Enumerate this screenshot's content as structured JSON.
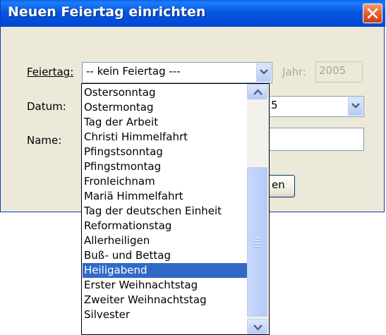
{
  "window": {
    "title": "Neuen Feiertag einrichten"
  },
  "form": {
    "holiday_label": "Feiertag:",
    "holiday_selected": "-- kein Feiertag ---",
    "year_label": "Jahr:",
    "year_value": "2005",
    "date_label": "Datum:",
    "date_value_partial": "5",
    "name_label": "Name:",
    "name_value": "",
    "button_partial_label": "en"
  },
  "dropdown": {
    "items": [
      "Ostersonntag",
      "Ostermontag",
      "Tag der Arbeit",
      "Christi Himmelfahrt",
      "Pfingstsonntag",
      "Pfingstmontag",
      "Fronleichnam",
      "Mariä Himmelfahrt",
      "Tag der deutschen Einheit",
      "Reformationstag",
      "Allerheiligen",
      "Buß- und Bettag",
      "Heiligabend",
      "Erster Weihnachtstag",
      "Zweiter Weihnachtstag",
      "Silvester"
    ],
    "selected": "Heiligabend"
  },
  "colors": {
    "titlebar": "#0054e3",
    "selection": "#316ac5",
    "close_button": "#e05a23",
    "dialog_face": "#ece9d8"
  },
  "icons": {
    "close": "close-icon",
    "dropdown": "chevron-down-icon",
    "scroll_up": "chevron-up-icon",
    "scroll_down": "chevron-down-icon"
  }
}
